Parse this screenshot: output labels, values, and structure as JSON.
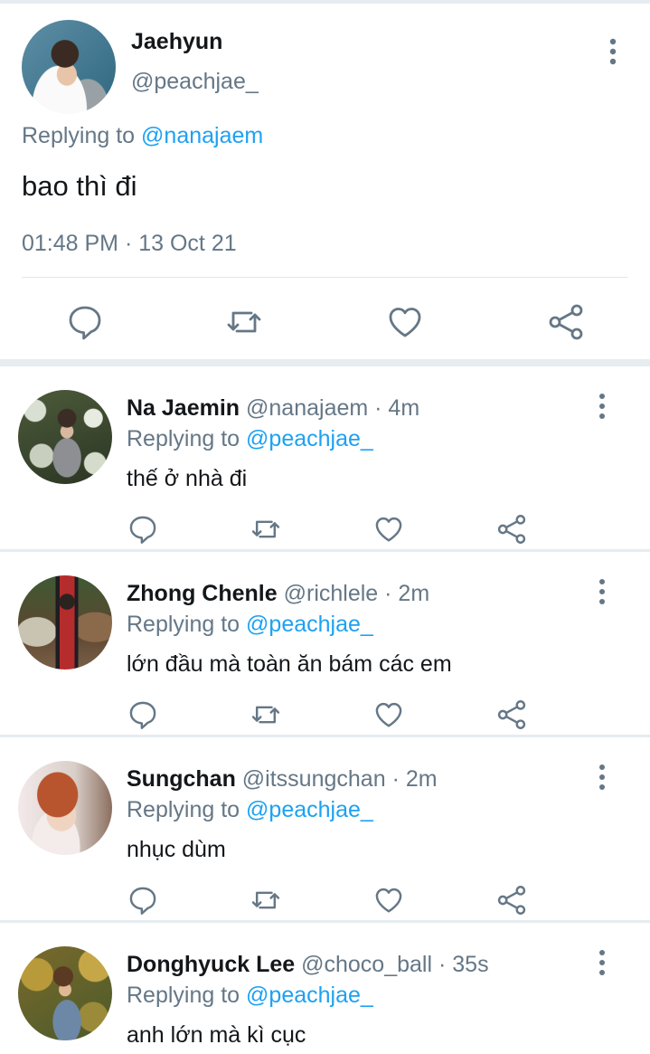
{
  "colors": {
    "accent": "#1da1f2",
    "secondary_text": "#657786",
    "primary_text": "#14171a",
    "separator": "#e6ecf0"
  },
  "main_tweet": {
    "name": "Jaehyun",
    "handle": "@peachjae_",
    "replying_prefix": "Replying to",
    "replying_to": "@nanajaem",
    "text": "bao thì đi",
    "timestamp": "01:48 PM · 13 Oct 21",
    "actions": [
      "reply-icon",
      "retweet-icon",
      "like-icon",
      "share-icon"
    ]
  },
  "replies": [
    {
      "name": "Na Jaemin",
      "handle": "@nanajaem",
      "time": "· 4m",
      "replying_prefix": "Replying to",
      "replying_to": "@peachjae_",
      "text": "thế ở nhà đi"
    },
    {
      "name": "Zhong Chenle",
      "handle": "@richlele",
      "time": "· 2m",
      "replying_prefix": "Replying to",
      "replying_to": "@peachjae_",
      "text": "lớn đầu mà toàn ăn bám các em"
    },
    {
      "name": "Sungchan",
      "handle": "@itssungchan",
      "time": "· 2m",
      "replying_prefix": "Replying to",
      "replying_to": "@peachjae_",
      "text": "nhục dùm"
    },
    {
      "name": "Donghyuck Lee",
      "handle": "@choco_ball",
      "time": "· 35s",
      "replying_prefix": "Replying to",
      "replying_to": "@peachjae_",
      "text": "anh lớn mà kì cục"
    }
  ]
}
